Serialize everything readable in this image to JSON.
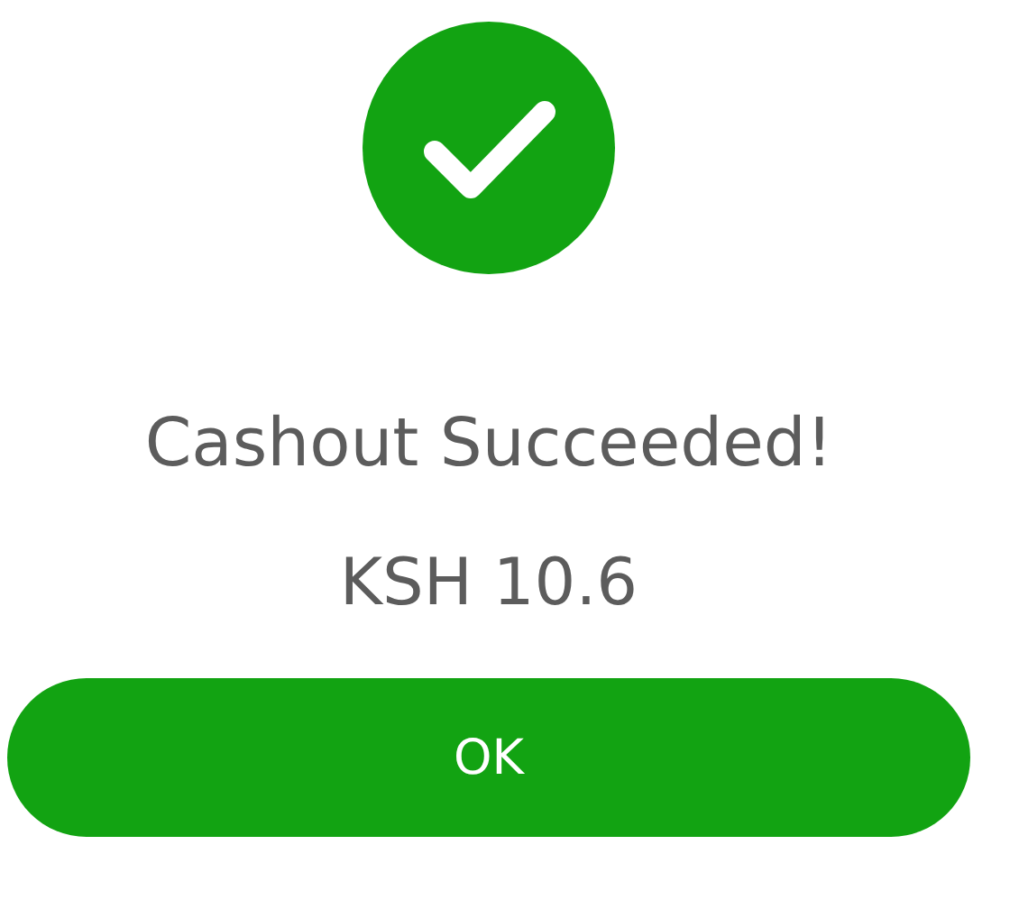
{
  "title": "Cashout Succeeded!",
  "amount": "KSH 10.6",
  "button": {
    "label": "OK"
  }
}
